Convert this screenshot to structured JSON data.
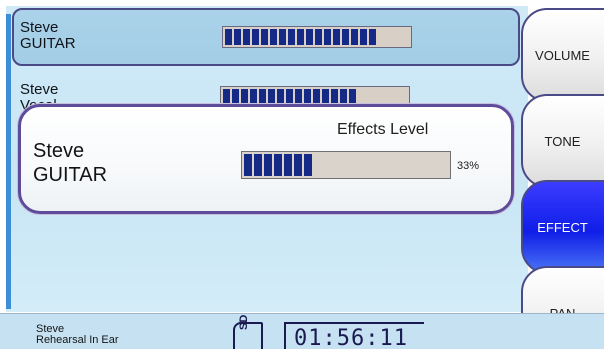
{
  "channels": [
    {
      "name": "Steve\nGUITAR",
      "level_percent": 87
    },
    {
      "name": "Steve\nVocal",
      "level_percent": 75
    }
  ],
  "popup": {
    "title": "Effects Level",
    "name": "Steve\nGUITAR",
    "level_percent": 33,
    "percent_label": "33%"
  },
  "tabs": [
    {
      "label": "VOLUME",
      "active": false
    },
    {
      "label": "TONE",
      "active": false
    },
    {
      "label": "EFFECT",
      "active": true
    },
    {
      "label": "PAN",
      "active": false
    }
  ],
  "status": {
    "name": "Steve\nRehearsal In Ear",
    "storage_label": "SD",
    "time": "01:56:11"
  },
  "colors": {
    "meter_fill": "#152a86",
    "active_tab": "#1b2af0",
    "border": "#4a4a86",
    "panel": "#cfe9f6"
  }
}
